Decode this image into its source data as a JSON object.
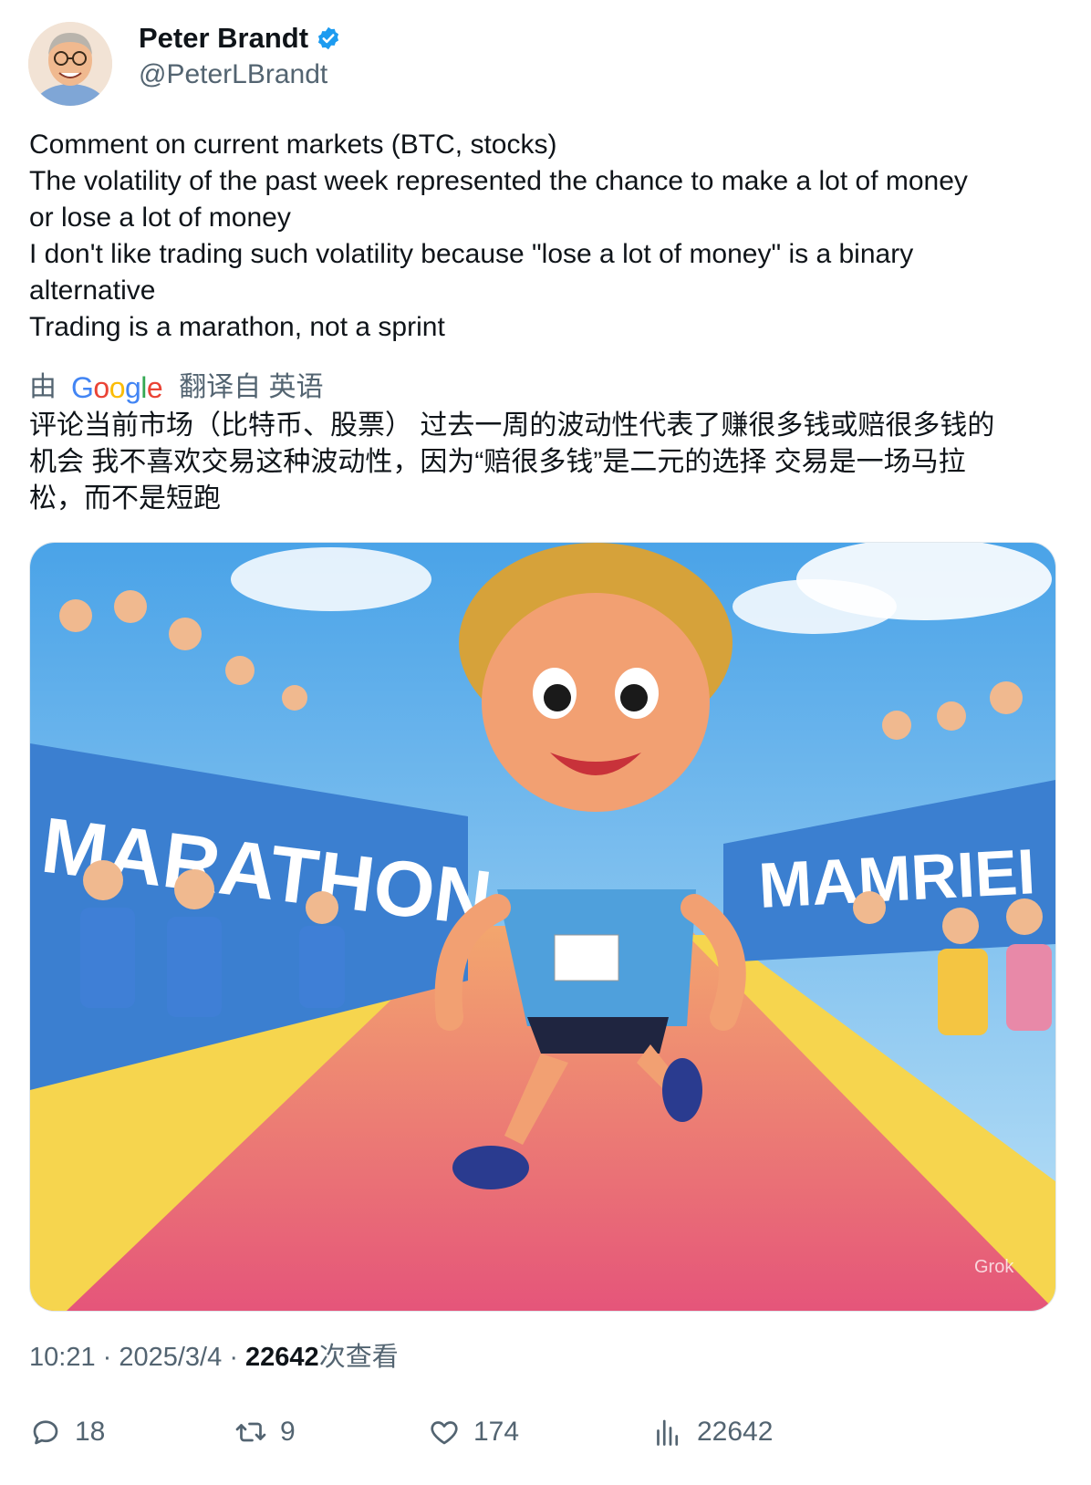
{
  "author": {
    "name": "Peter Brandt",
    "handle": "@PeterLBrandt",
    "verified_icon": "verified-badge-icon"
  },
  "tweet": {
    "lines": [
      "Comment on current markets (BTC, stocks)",
      "The volatility of the past week represented the chance to make a lot of money",
      "or lose a lot of money",
      "I don't like trading such volatility because \"lose a lot of money\" is a binary",
      "alternative",
      "Trading is a marathon, not a sprint"
    ]
  },
  "translation": {
    "prefix": "由",
    "provider": "Google",
    "suffix": "翻译自 英语",
    "lines": [
      "评论当前市场（比特币、股票） 过去一周的波动性代表了赚很多钱或赔很多钱的",
      "机会 我不喜欢交易这种波动性，因为“赔很多钱”是二元的选择 交易是一场马拉",
      "松，而不是短跑"
    ]
  },
  "media": {
    "banner_left": "MARATHON",
    "banner_right": "MAMRIEI",
    "watermark": "Grok"
  },
  "meta": {
    "time": "10:21",
    "date": "2025/3/4",
    "views": "22642",
    "views_suffix": "次查看"
  },
  "actions": {
    "replies": "18",
    "reposts": "9",
    "likes": "174",
    "views": "22642"
  },
  "colors": {
    "brand_blue": "#1d9bf0",
    "secondary_text": "#536471"
  }
}
